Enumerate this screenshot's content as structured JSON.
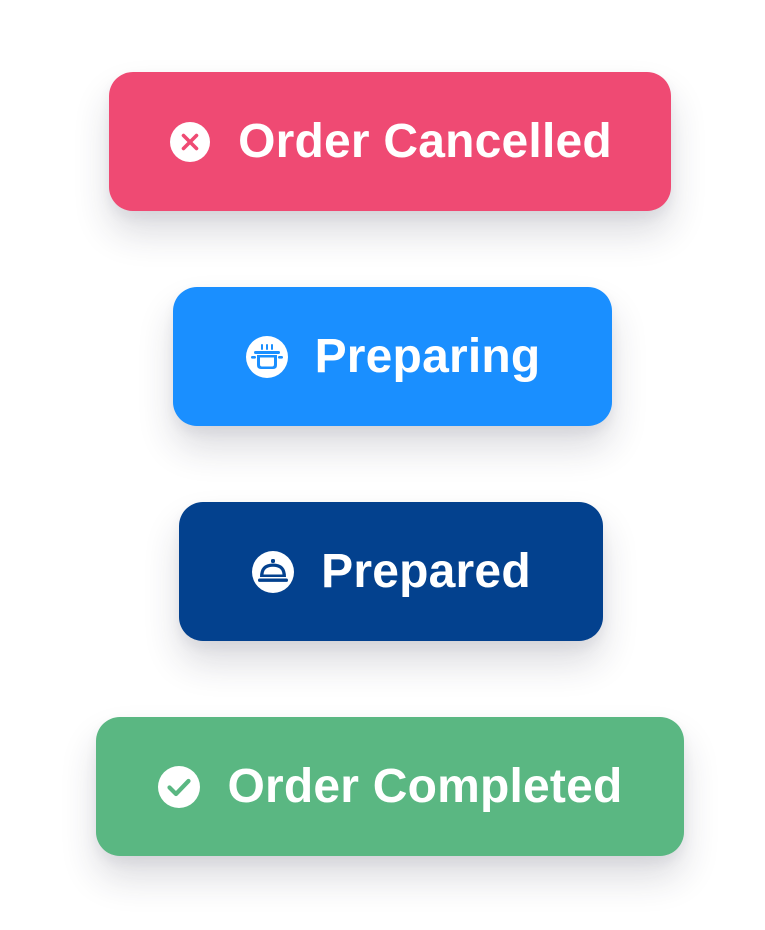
{
  "buttons": {
    "cancelled": {
      "label": "Order Cancelled",
      "icon": "x-circle-icon",
      "color": "#EF4A73"
    },
    "preparing": {
      "label": "Preparing",
      "icon": "cooking-pot-icon",
      "color": "#1A8FFF"
    },
    "prepared": {
      "label": "Prepared",
      "icon": "serving-cloche-icon",
      "color": "#03418E"
    },
    "completed": {
      "label": "Order Completed",
      "icon": "check-circle-icon",
      "color": "#5AB782"
    }
  }
}
